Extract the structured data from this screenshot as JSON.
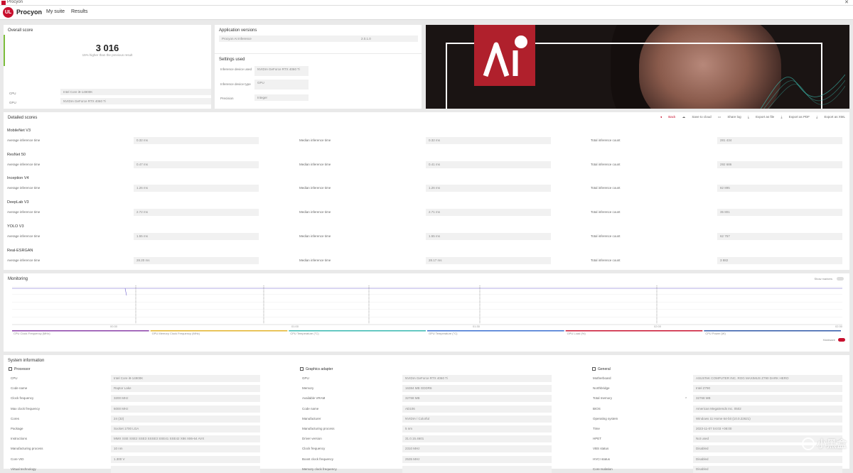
{
  "window": {
    "title": "Procyon"
  },
  "nav": {
    "logo": "UL",
    "brand": "Procyon",
    "links": [
      "My suite",
      "Results"
    ]
  },
  "overall": {
    "title": "Overall score",
    "score": "3 016",
    "subtitle": "15% higher than the previous result",
    "rows": [
      {
        "label": "CPU",
        "value": "Intel Core i9-14900K"
      },
      {
        "label": "GPU",
        "value": "NVIDIA GeForce RTX 4060 Ti"
      }
    ]
  },
  "appver": {
    "title": "Application versions",
    "name": "Procyon AI Inference",
    "version": "2.0.1.0"
  },
  "settings": {
    "title": "Settings used",
    "rows": [
      {
        "label": "Inference device used",
        "value": "NVIDIA GeForce RTX 4060 Ti"
      },
      {
        "label": "Inference device type",
        "value": "GPU"
      },
      {
        "label": "Precision",
        "value": "Integer"
      }
    ]
  },
  "detailed": {
    "title": "Detailed scores",
    "toolbar": [
      "Back",
      "Save to cloud",
      "Share log",
      "Export as file",
      "Export as PDF",
      "Export as XML"
    ],
    "labels": {
      "avg": "Average inference time",
      "median": "Median inference time",
      "total": "Total inference count"
    },
    "tests": [
      {
        "name": "MobileNet V3",
        "avg": "0.32 ms",
        "median": "0.32 ms",
        "total": "281 434"
      },
      {
        "name": "ResNet 50",
        "avg": "0.47 ms",
        "median": "0.41 ms",
        "total": "292 686"
      },
      {
        "name": "Inception V4",
        "avg": "1.26 ms",
        "median": "1.26 ms",
        "total": "82 895"
      },
      {
        "name": "DeepLab V3",
        "avg": "2.72 ms",
        "median": "2.71 ms",
        "total": "35 801"
      },
      {
        "name": "YOLO V3",
        "avg": "1.55 ms",
        "median": "1.55 ms",
        "total": "62 757"
      },
      {
        "name": "Real-ESRGAN",
        "avg": "28.20 ms",
        "median": "28.17 ms",
        "total": "3 882"
      }
    ]
  },
  "monitoring": {
    "title": "Monitoring",
    "markers": "Show markers",
    "legend": [
      {
        "label": "CPU Clock Frequency (MHz)",
        "color": "#8a3fa8"
      },
      {
        "label": "GPU Memory Clock Frequency (MHz)",
        "color": "#e3b32a"
      },
      {
        "label": "CPU Temperature (°C)",
        "color": "#37b8b0"
      },
      {
        "label": "GPU Temperature (°C)",
        "color": "#3a6fd0"
      },
      {
        "label": "GPU Load (%)",
        "color": "#c8102e"
      },
      {
        "label": "CPU Power (W)",
        "color": "#2e57a8"
      }
    ],
    "ticks": [
      "00:30",
      "01:00",
      "01:30",
      "02:00",
      "02:30"
    ],
    "toggle_label": "Hardware"
  },
  "sysinfo": {
    "title": "System information",
    "processor": {
      "title": "Processor",
      "rows": [
        {
          "label": "CPU",
          "value": "Intel Core i9-14900K"
        },
        {
          "label": "Code name",
          "value": "Raptor Lake"
        },
        {
          "label": "Clock frequency",
          "value": "3200 MHz"
        },
        {
          "label": "Max clock frequency",
          "value": "6000 MHz"
        },
        {
          "label": "Cores",
          "value": "24 (32)"
        },
        {
          "label": "Package",
          "value": "Socket 1700 LGA"
        },
        {
          "label": "Instructions",
          "value": "MMX SSE SSE2 SSE3 SSSE3 SSE41 SSE42 X86 X86-64 AVX"
        },
        {
          "label": "Manufacturing process",
          "value": "10 nm"
        },
        {
          "label": "Core VID",
          "value": "1.300 V"
        },
        {
          "label": "Virtual technology",
          "value": ""
        }
      ]
    },
    "graphics": {
      "title": "Graphics adapter",
      "rows": [
        {
          "label": "GPU",
          "value": "NVIDIA GeForce RTX 4060 Ti"
        },
        {
          "label": "Memory",
          "value": "16384 MB GDDR6"
        },
        {
          "label": "Available VRAM",
          "value": "32768 MB"
        },
        {
          "label": "Code name",
          "value": "AD106"
        },
        {
          "label": "Manufacturer",
          "value": "NVIDIA / Colorful"
        },
        {
          "label": "Manufacturing process",
          "value": "5 nm"
        },
        {
          "label": "Driver version",
          "value": "31.0.15.4601"
        },
        {
          "label": "Clock frequency",
          "value": "2310 MHz"
        },
        {
          "label": "Boost clock frequency",
          "value": "2535 MHz"
        },
        {
          "label": "Memory clock frequency",
          "value": ""
        }
      ]
    },
    "general": {
      "title": "General",
      "rows": [
        {
          "label": "Motherboard",
          "value": "ASUSTeK COMPUTER INC. ROG MAXIMUS Z790 DARK HERO"
        },
        {
          "label": "Northbridge",
          "value": "Intel Z790"
        },
        {
          "label": "Total memory",
          "value": "32768 MB"
        },
        {
          "label": "BIOS",
          "value": "American Megatrends Inc. 0502"
        },
        {
          "label": "Operating system",
          "value": "Windows 11 Home 64-bit (10.0.22621)"
        },
        {
          "label": "Time",
          "value": "2023-11-07 04:03 +08:00"
        },
        {
          "label": "HPET",
          "value": "Not used"
        },
        {
          "label": "VBS status",
          "value": "Disabled"
        },
        {
          "label": "HVCI status",
          "value": "Disabled"
        },
        {
          "label": "Core Isolation",
          "value": "Disabled"
        }
      ]
    }
  },
  "watermark": {
    "text": "小黑盒"
  }
}
